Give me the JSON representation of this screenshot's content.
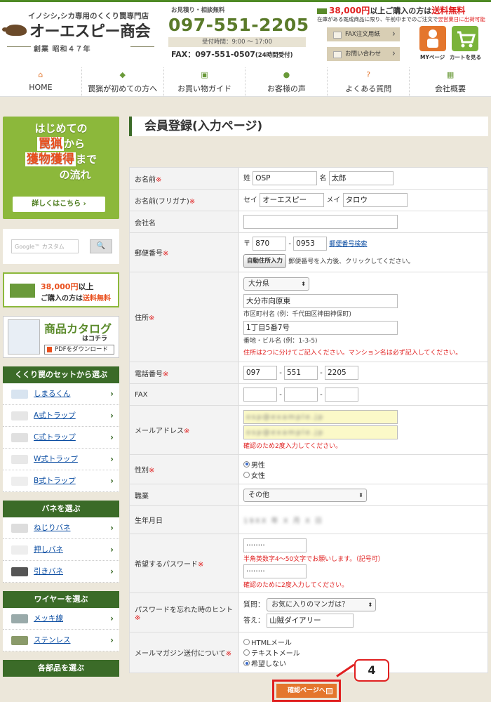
{
  "header": {
    "tagline": "イノシシ,シカ専用のくくり罠専門店",
    "logo": "オーエスピー商会",
    "founded": "創業 昭和４７年",
    "estimate_label": "お見積り・相談無料",
    "phone": "097-551-2205",
    "hours": "受付時間：9:00 〜 17:00",
    "fax": "FAX：097-551-0507",
    "fax_note": "(24時間受付)",
    "shipping_amount": "38,000円",
    "shipping_mid": "以上ご購入の方は",
    "shipping_free": "送料無料",
    "shipping_sub_1": "在庫がある既成商品に限り、午前中までのご注文で",
    "shipping_sub_2": "翌営業日に出荷可能",
    "fax_form_btn": "FAX注文用紙",
    "contact_btn": "お問い合わせ",
    "mypage_label": "MYページ",
    "cart_label": "カートを見る"
  },
  "nav": [
    {
      "label": "HOME",
      "icon": "⌂",
      "color": "#e4762d"
    },
    {
      "label": "罠猟が初めての方へ",
      "icon": "◆",
      "color": "#6a9a3a"
    },
    {
      "label": "お買い物ガイド",
      "icon": "▣",
      "color": "#6a9a3a"
    },
    {
      "label": "お客様の声",
      "icon": "●",
      "color": "#6a9a3a"
    },
    {
      "label": "よくある質問",
      "icon": "?",
      "color": "#e4762d"
    },
    {
      "label": "会社概要",
      "icon": "▦",
      "color": "#6a9a3a"
    }
  ],
  "sidebar": {
    "banner1_l1": "はじめての",
    "banner1_big1": "罠猟",
    "banner1_l2": "から",
    "banner1_big2": "獲物獲得",
    "banner1_l3": "まで",
    "banner1_l4": "の流れ",
    "banner1_btn": "詳しくはこちら ›",
    "search_placeholder": "Google™ カスタム",
    "search_btn": "🔍",
    "ship_amount": "38,000円",
    "ship_rest": "以上",
    "ship_line2a": "ご購入の方は",
    "ship_line2b": "送料無料",
    "catalog_title": "商品カタログ",
    "catalog_sub": "はコチラ",
    "catalog_dl": "PDFをダウンロード",
    "cat1_title": "くくり罠のセットから選ぶ",
    "cat1_items": [
      "しまるくん",
      "A式トラップ",
      "C式トラップ",
      "W式トラップ",
      "B式トラップ"
    ],
    "cat2_title": "バネを選ぶ",
    "cat2_items": [
      "ねじりバネ",
      "押しバネ",
      "引きバネ"
    ],
    "cat3_title": "ワイヤーを選ぶ",
    "cat3_items": [
      "メッキ線",
      "ステンレス"
    ],
    "cat4_title": "各部品を選ぶ"
  },
  "page_title": "会員登録(入力ページ)",
  "form": {
    "name_label": "お名前",
    "sei_label": "姓",
    "sei": "OSP",
    "mei_label": "名",
    "mei": "太郎",
    "kana_label": "お名前(フリガナ)",
    "kana_sei_label": "セイ",
    "kana_sei": "オーエスピー",
    "kana_mei_label": "メイ",
    "kana_mei": "タロウ",
    "company_label": "会社名",
    "zip_label": "郵便番号",
    "zip_mark": "〒",
    "zip1": "870",
    "zip2": "0953",
    "zip_link": "郵便番号検索",
    "auto_btn": "自動住所入力",
    "auto_note": "郵便番号を入力後、クリックしてください。",
    "addr_label": "住所",
    "pref": "大分県",
    "city": "大分市向原東",
    "city_note": "市区町村名 (例：千代田区神田神保町)",
    "street": "1丁目5番7号",
    "street_note": "番地・ビル名 (例：1-3-5)",
    "addr_warn": "住所は2つに分けてご記入ください。マンション名は必ず記入してください。",
    "tel_label": "電話番号",
    "tel1": "097",
    "tel2": "551",
    "tel3": "2205",
    "fax_label": "FAX",
    "email_label": "メールアドレス",
    "email_blur": "osp@example.jp",
    "email_note": "確認のため2度入力してください。",
    "sex_label": "性別",
    "sex_male": "男性",
    "sex_female": "女性",
    "job_label": "職業",
    "job": "その他",
    "birth_label": "生年月日",
    "birth_blur": "19XX 年 X 月 X 日",
    "pw_label": "希望するパスワード",
    "pw1": "········",
    "pw_note1": "半角英数字4〜50文字でお願いします。（記号可）",
    "pw2": "········",
    "pw_note2": "確認のために2度入力してください。",
    "hint_label": "パスワードを忘れた時のヒント",
    "hint_q_label": "質問：",
    "hint_q": "お気に入りのマンガは？",
    "hint_a_label": "答え：",
    "hint_a": "山賊ダイアリー",
    "mag_label": "メールマガジン送付について",
    "mag_html": "HTMLメール",
    "mag_text": "テキストメール",
    "mag_none": "希望しない",
    "req": "※"
  },
  "submit_label": "確認ページへ",
  "callout_number": "4",
  "colors": {
    "brand_green": "#3b6b28",
    "accent_orange": "#e4762d",
    "alert_red": "#e02020"
  }
}
